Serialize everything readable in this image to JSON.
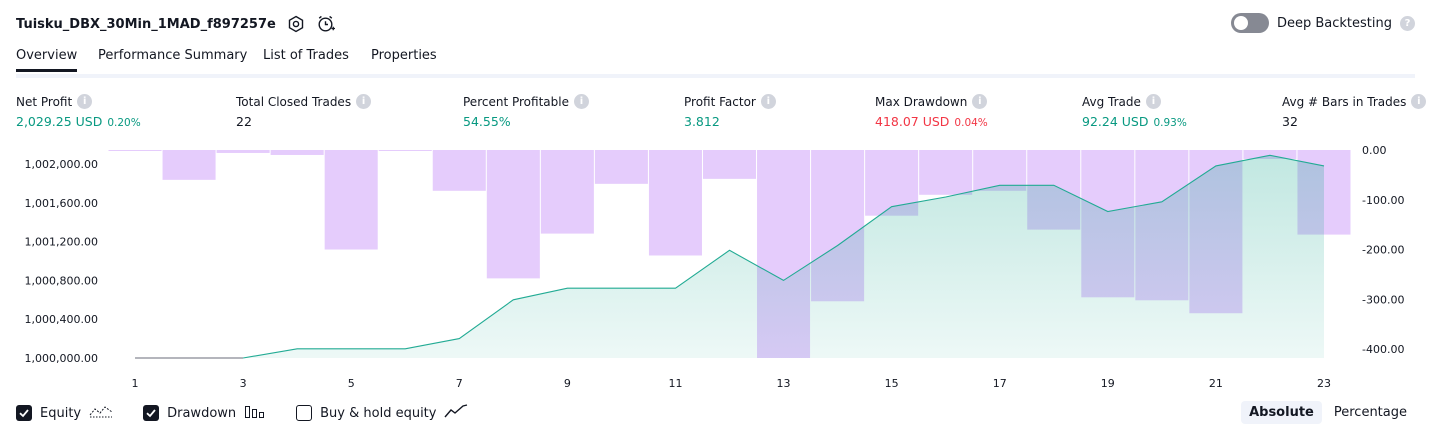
{
  "header": {
    "title": "Tuisku_DBX_30Min_1MAD_f897257e",
    "deep_backtesting_label": "Deep Backtesting"
  },
  "tabs": [
    {
      "label": "Overview",
      "active": true
    },
    {
      "label": "Performance Summary",
      "active": false
    },
    {
      "label": "List of Trades",
      "active": false
    },
    {
      "label": "Properties",
      "active": false
    }
  ],
  "metrics": [
    {
      "label": "Net Profit",
      "value": "2,029.25 USD",
      "pct": "0.20%",
      "color": "green"
    },
    {
      "label": "Total Closed Trades",
      "value": "22",
      "pct": "",
      "color": "dark"
    },
    {
      "label": "Percent Profitable",
      "value": "54.55%",
      "pct": "",
      "color": "green"
    },
    {
      "label": "Profit Factor",
      "value": "3.812",
      "pct": "",
      "color": "green"
    },
    {
      "label": "Max Drawdown",
      "value": "418.07 USD",
      "pct": "0.04%",
      "color": "red"
    },
    {
      "label": "Avg Trade",
      "value": "92.24 USD",
      "pct": "0.93%",
      "color": "green"
    },
    {
      "label": "Avg # Bars in Trades",
      "value": "32",
      "pct": "",
      "color": "dark"
    }
  ],
  "chart_data": {
    "type": "area",
    "x": [
      1,
      2,
      3,
      4,
      5,
      6,
      7,
      8,
      9,
      10,
      11,
      12,
      13,
      14,
      15,
      16,
      17,
      18,
      19,
      20,
      21,
      22,
      23
    ],
    "x_ticks": [
      "1",
      "3",
      "5",
      "7",
      "9",
      "11",
      "13",
      "15",
      "17",
      "19",
      "21",
      "23"
    ],
    "left_axis_ticks": [
      "1,002,000.00",
      "1,001,600.00",
      "1,001,200.00",
      "1,000,800.00",
      "1,000,400.00",
      "1,000,000.00"
    ],
    "right_axis_ticks": [
      "0.00",
      "-100.00",
      "-200.00",
      "-300.00",
      "-400.00"
    ],
    "left_ylim": [
      1000000,
      1002000
    ],
    "right_ylim": [
      -418,
      0
    ],
    "series": [
      {
        "name": "Equity",
        "axis": "left",
        "color": "#22ab94",
        "values": [
          1000000,
          1000000,
          1000000,
          1000095,
          1000095,
          1000095,
          1000200,
          1000600,
          1000720,
          1000720,
          1000720,
          1001110,
          1000800,
          1001160,
          1001560,
          1001660,
          1001780,
          1001780,
          1001510,
          1001610,
          1001980,
          1002090,
          1001980
        ]
      },
      {
        "name": "Drawdown",
        "axis": "right",
        "color": "#e1c3fc",
        "values": [
          -2,
          -60,
          -6,
          -10,
          -200,
          0,
          -82,
          -258,
          -168,
          -68,
          -212,
          -58,
          -418,
          -304,
          -132,
          -90,
          -82,
          -160,
          -296,
          -302,
          -328,
          -18,
          -170
        ]
      }
    ]
  },
  "legend": {
    "items": [
      {
        "label": "Equity",
        "checked": true
      },
      {
        "label": "Drawdown",
        "checked": true
      },
      {
        "label": "Buy & hold equity",
        "checked": false
      }
    ]
  },
  "modes": [
    {
      "label": "Absolute",
      "active": true
    },
    {
      "label": "Percentage",
      "active": false
    }
  ],
  "colors": {
    "accent": "#131722",
    "green": "#089981",
    "red": "#f23645"
  }
}
